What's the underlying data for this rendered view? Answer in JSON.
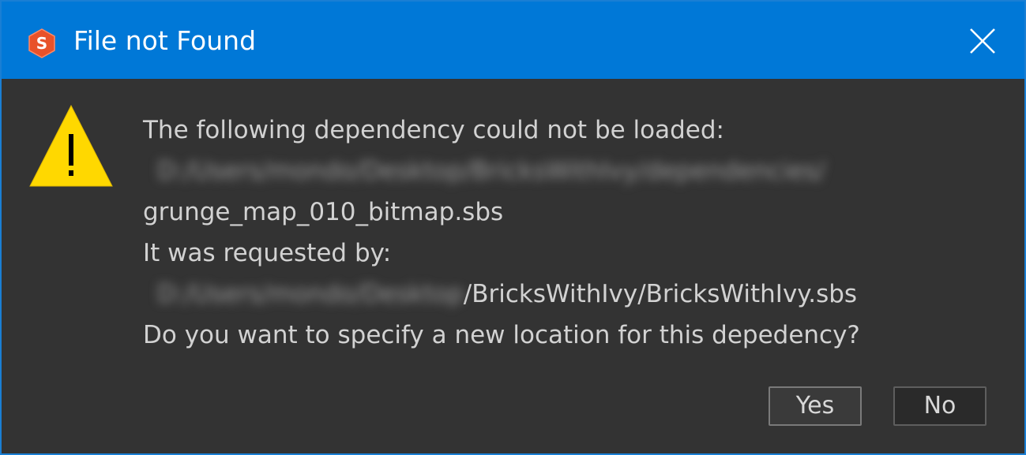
{
  "window": {
    "title": "File not Found",
    "app_icon": "substance-designer-icon",
    "accent": "#0078d7"
  },
  "message": {
    "line1": "The following dependency could not be loaded:",
    "dependency_path_blurred": "D:/Users/mondo/Desktop/BricksWithIvy/dependencies/",
    "dependency_file": "grunge_map_010_bitmap.sbs",
    "requested_label": "It was requested by:",
    "requester_path_blurred": "D:/Users/mondo/Desktop",
    "requester_path_visible": "/BricksWithIvy/BricksWithIvy.sbs",
    "question": "Do you want to specify a new location for this depedency?"
  },
  "buttons": {
    "yes_label": "Yes",
    "no_label": "No"
  },
  "icons": {
    "warning": "warning-triangle-icon",
    "close": "close-icon"
  }
}
